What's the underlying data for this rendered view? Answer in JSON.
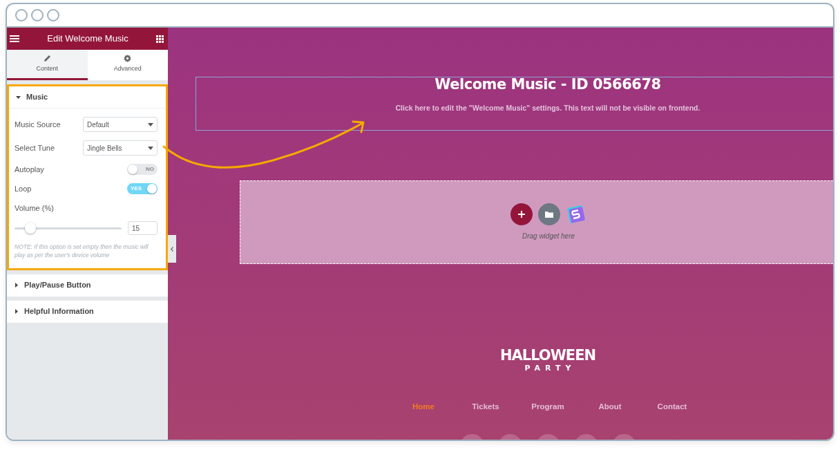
{
  "panel": {
    "title": "Edit Welcome Music",
    "tabs": [
      {
        "label": "Content",
        "selected": true
      },
      {
        "label": "Advanced",
        "selected": false
      }
    ],
    "sections": [
      {
        "title": "Music",
        "expanded": true,
        "highlighted": true,
        "fields": [
          {
            "kind": "select",
            "label": "Music Source",
            "value": "Default"
          },
          {
            "kind": "select",
            "label": "Select Tune",
            "value": "Jingle Bells"
          },
          {
            "kind": "switch",
            "label": "Autoplay",
            "on": false,
            "text": "NO"
          },
          {
            "kind": "switch",
            "label": "Loop",
            "on": true,
            "text": "YES"
          },
          {
            "kind": "slider",
            "label": "Volume (%)",
            "level": 0.15,
            "value": "15"
          }
        ],
        "note": "NOTE: If this option is set empty then the music will play as per the user's device volume"
      },
      {
        "title": "Play/Pause Button",
        "expanded": false,
        "highlighted": false
      },
      {
        "title": "Helpful Information",
        "expanded": false,
        "highlighted": false
      }
    ]
  },
  "canvas": {
    "widget": {
      "title": "Welcome Music - ID 0566678",
      "hint": "Click here to edit the \"Welcome Music\" settings. This text will not be visible on frontend."
    },
    "dropzone": {
      "hint": "Drag widget here"
    },
    "logo": {
      "title": "HALLOWEEN",
      "subtitle": "PARTY"
    },
    "nav": [
      {
        "label": "Home",
        "selected": true
      },
      {
        "label": "Tickets",
        "selected": false
      },
      {
        "label": "Program",
        "selected": false
      },
      {
        "label": "About",
        "selected": false
      },
      {
        "label": "Contact",
        "selected": false
      }
    ]
  }
}
